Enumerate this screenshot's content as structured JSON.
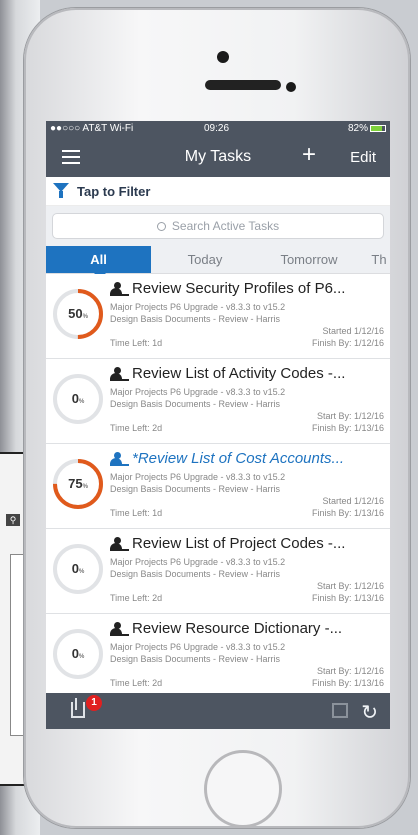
{
  "status": {
    "carrier": "●●○○○ AT&T Wi-Fi",
    "time": "09:26",
    "battery": "82%",
    "battery_level": 0.82
  },
  "nav": {
    "title": "My Tasks",
    "add": "+",
    "edit": "Edit"
  },
  "filter": {
    "label": "Tap to Filter"
  },
  "search": {
    "placeholder": "Search Active Tasks"
  },
  "tabs": [
    {
      "label": "All",
      "active": true
    },
    {
      "label": "Today"
    },
    {
      "label": "Tomorrow"
    },
    {
      "label": "Th"
    }
  ],
  "tasks": [
    {
      "percent": "50",
      "title": "Review Security Profiles of P6...",
      "project": "Major Projects P6 Upgrade - v8.3.3 to v15.2",
      "doc": "Design Basis Documents - Review - Harris",
      "date1": "Started 1/12/16",
      "date2": "Finish By: 1/12/16",
      "time_left": "Time Left: 1d"
    },
    {
      "percent": "0",
      "title": "Review List of Activity Codes -...",
      "project": "Major Projects P6 Upgrade - v8.3.3 to v15.2",
      "doc": "Design Basis Documents - Review - Harris",
      "date1": "Start By: 1/12/16",
      "date2": "Finish By: 1/13/16",
      "time_left": "Time Left: 2d"
    },
    {
      "percent": "75",
      "title": "*Review List of Cost Accounts...",
      "project": "Major Projects P6 Upgrade - v8.3.3 to v15.2",
      "doc": "Design Basis Documents - Review - Harris",
      "date1": "Started 1/12/16",
      "date2": "Finish By: 1/13/16",
      "time_left": "Time Left: 1d"
    },
    {
      "percent": "0",
      "title": "Review List of Project Codes -...",
      "project": "Major Projects P6 Upgrade - v8.3.3 to v15.2",
      "doc": "Design Basis Documents - Review - Harris",
      "date1": "Start By: 1/12/16",
      "date2": "Finish By: 1/13/16",
      "time_left": "Time Left: 2d"
    },
    {
      "percent": "0",
      "title": "Review Resource Dictionary -...",
      "project": "Major Projects P6 Upgrade - v8.3.3 to v15.2",
      "doc": "Design Basis Documents - Review - Harris",
      "date1": "Start By: 1/12/16",
      "date2": "Finish By: 1/13/16",
      "time_left": "Time Left: 2d"
    }
  ],
  "bottom": {
    "badge": "1"
  },
  "colors": {
    "accent": "#1e73c0",
    "progress": "#e05a1c",
    "bar": "#4d5561"
  }
}
